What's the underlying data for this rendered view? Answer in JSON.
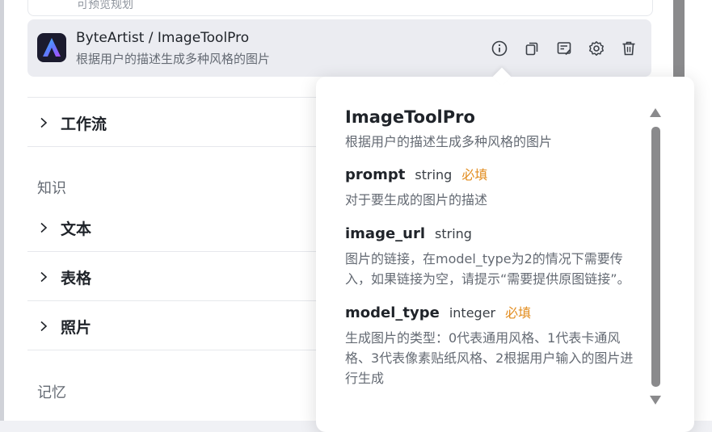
{
  "top_card": {
    "partial_text": "可预览规划"
  },
  "plugin": {
    "title": "ByteArtist / ImageToolPro",
    "description": "根据用户的描述生成多种风格的图片",
    "actions": [
      "info-icon",
      "copy-icon",
      "edit-icon",
      "gear-icon",
      "trash-icon"
    ]
  },
  "sidebar": {
    "workflow_label": "工作流",
    "knowledge_section": "知识",
    "knowledge_items": [
      {
        "label": "文本"
      },
      {
        "label": "表格"
      },
      {
        "label": "照片"
      }
    ],
    "memory_section": "记忆"
  },
  "popover": {
    "title": "ImageToolPro",
    "description": "根据用户的描述生成多种风格的图片",
    "params": [
      {
        "name": "prompt",
        "type": "string",
        "required": "必填",
        "description": "对于要生成的图片的描述"
      },
      {
        "name": "image_url",
        "type": "string",
        "required": "",
        "description": "图片的链接，在model_type为2的情况下需要传入，如果链接为空，请提示“需要提供原图链接”。"
      },
      {
        "name": "model_type",
        "type": "integer",
        "required": "必填",
        "description": "生成图片的类型：0代表通用风格、1代表卡通风格、3代表像素贴纸风格、2根据用户输入的图片进行生成"
      }
    ]
  },
  "colors": {
    "required": "#e28c1e",
    "card_bg": "#ebecf1",
    "scrollbar": "#8a8a8c"
  }
}
